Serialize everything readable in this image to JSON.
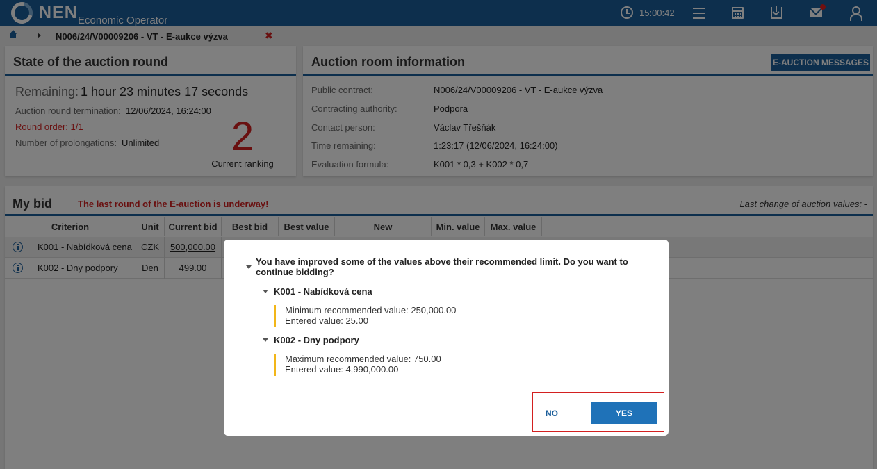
{
  "header": {
    "logo_text": "NEN",
    "subtitle": "Economic Operator",
    "time": "15:00:42"
  },
  "breadcrumb": {
    "text": "N006/24/V00009206 - VT - E-aukce výzva",
    "close": "✖"
  },
  "state_panel": {
    "title": "State of the auction round",
    "remaining_label": "Remaining:",
    "remaining_value": "1 hour 23 minutes 17 seconds",
    "termination_label": "Auction round termination:",
    "termination_value": "12/06/2024, 16:24:00",
    "round_order": "Round order: 1/1",
    "prolongations_label": "Number of prolongations:",
    "prolongations_value": "Unlimited",
    "ranking": "2",
    "ranking_label": "Current ranking"
  },
  "info_panel": {
    "title": "Auction room information",
    "messages_button": "E-AUCTION MESSAGES",
    "rows": [
      {
        "label": "Public contract:",
        "value": "N006/24/V00009206 - VT - E-aukce výzva"
      },
      {
        "label": "Contracting authority:",
        "value": "Podpora"
      },
      {
        "label": "Contact person:",
        "value": "Václav Třešňák"
      },
      {
        "label": "Time remaining:",
        "value": "1:23:17 (12/06/2024, 16:24:00)"
      },
      {
        "label": "Evaluation formula:",
        "value": "K001 * 0,3 + K002 * 0,7"
      }
    ]
  },
  "bid_panel": {
    "title": "My bid",
    "warning": "The last round of the E-auction is underway!",
    "last_change": "Last change of auction values: -",
    "columns": [
      "Criterion",
      "Unit",
      "Current bid",
      "Best bid",
      "Best value",
      "New",
      "Min. value",
      "Max. value"
    ],
    "rows": [
      {
        "criterion": "K001 - Nabídková cena",
        "unit": "CZK",
        "current_bid": "500,000.00"
      },
      {
        "criterion": "K002 - Dny podpory",
        "unit": "Den",
        "current_bid": "499.00"
      }
    ]
  },
  "dialog": {
    "question": "You have improved some of the values above their recommended limit. Do you want to continue bidding?",
    "criteria": [
      {
        "title": "K001 - Nabídková cena",
        "line1": "Minimum recommended value: 250,000.00",
        "line2": "Entered value: 25.00"
      },
      {
        "title": "K002 - Dny podpory",
        "line1": "Maximum recommended value: 750.00",
        "line2": "Entered value: 4,990,000.00"
      }
    ],
    "no_label": "NO",
    "yes_label": "YES"
  },
  "colors": {
    "brand": "#1b5e9a",
    "alert": "#d32020",
    "highlight": "#f2b619"
  }
}
